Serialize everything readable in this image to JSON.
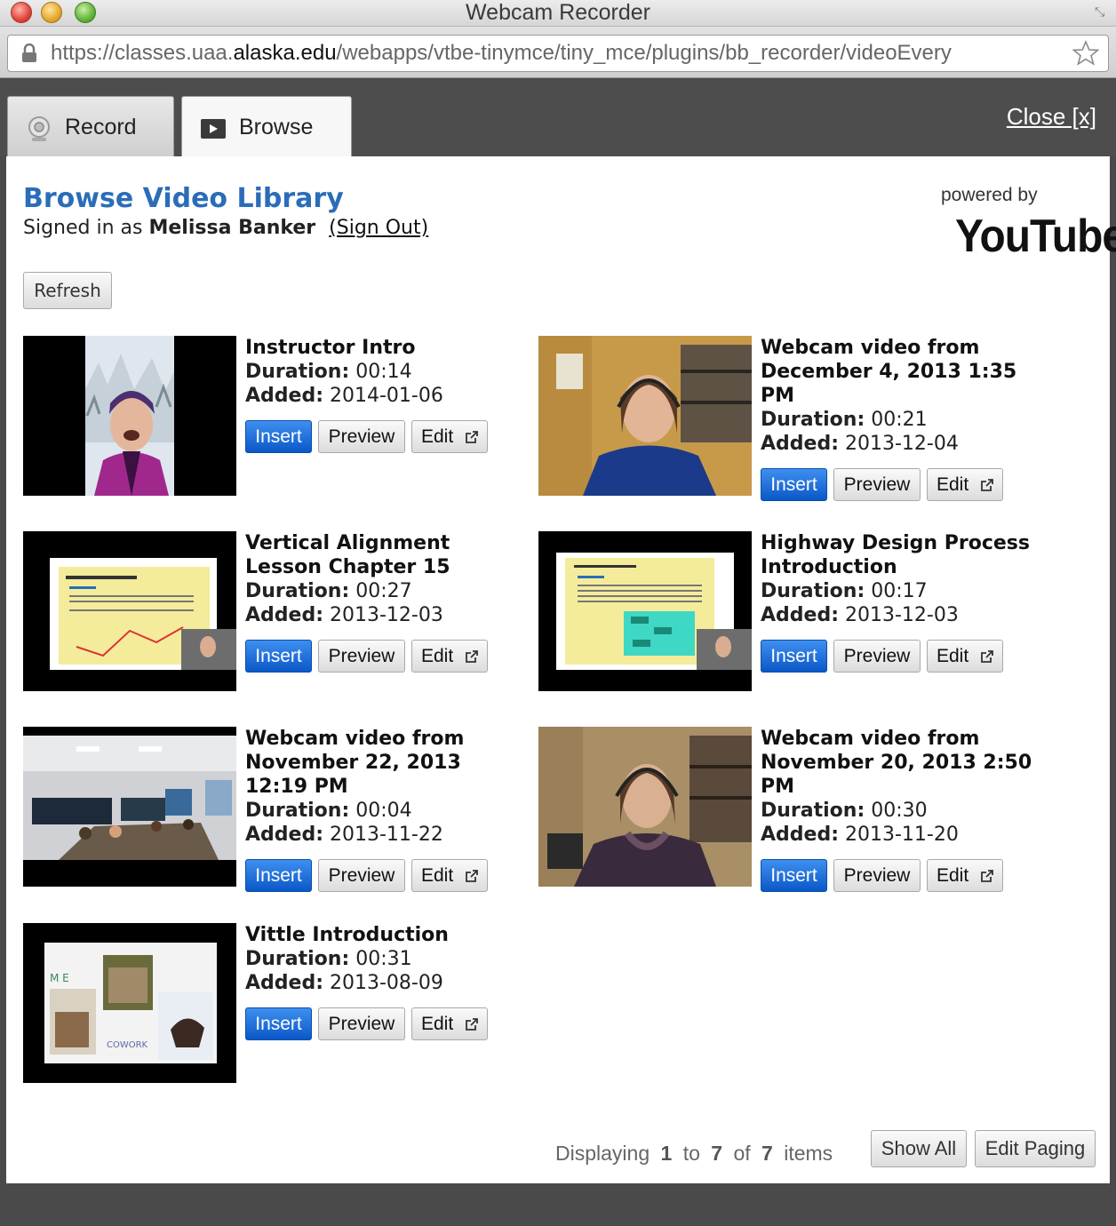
{
  "window": {
    "title": "Webcam Recorder"
  },
  "url": {
    "prefix": "https://classes.uaa.",
    "domain": "alaska.edu",
    "path": "/webapps/vtbe-tinymce/tiny_mce/plugins/bb_recorder/videoEvery"
  },
  "tabs": [
    {
      "label": "Record",
      "icon": "webcam-icon"
    },
    {
      "label": "Browse",
      "icon": "play-icon"
    }
  ],
  "close_label": "Close [x]",
  "library": {
    "title": "Browse Video Library",
    "signed_in_prefix": "Signed in as",
    "user": "Melissa Banker",
    "sign_out": "(Sign Out)",
    "powered_by": "powered by",
    "brand": "YouTube",
    "refresh": "Refresh"
  },
  "labels": {
    "duration": "Duration:",
    "added": "Added:",
    "insert": "Insert",
    "preview": "Preview",
    "edit": "Edit"
  },
  "videos": [
    {
      "title": "Instructor Intro",
      "duration": "00:14",
      "added": "2014-01-06"
    },
    {
      "title": "Webcam video from December 4, 2013 1:35 PM",
      "duration": "00:21",
      "added": "2013-12-04"
    },
    {
      "title": "Vertical Alignment Lesson Chapter 15",
      "duration": "00:27",
      "added": "2013-12-03"
    },
    {
      "title": "Highway Design Process Introduction",
      "duration": "00:17",
      "added": "2013-12-03"
    },
    {
      "title": "Webcam video from November 22, 2013 12:19 PM",
      "duration": "00:04",
      "added": "2013-11-22"
    },
    {
      "title": "Webcam video from November 20, 2013 2:50 PM",
      "duration": "00:30",
      "added": "2013-11-20"
    },
    {
      "title": "Vittle Introduction",
      "duration": "00:31",
      "added": "2013-08-09"
    }
  ],
  "paging": {
    "displaying": "Displaying",
    "from": "1",
    "to_label": "to",
    "to": "7",
    "of_label": "of",
    "total": "7",
    "items_label": "items",
    "show_all": "Show All",
    "edit_paging": "Edit Paging"
  },
  "colors": {
    "link_blue": "#2a6db8",
    "insert_blue": "#0a58c8",
    "chrome_dark": "#4a4a4a"
  }
}
